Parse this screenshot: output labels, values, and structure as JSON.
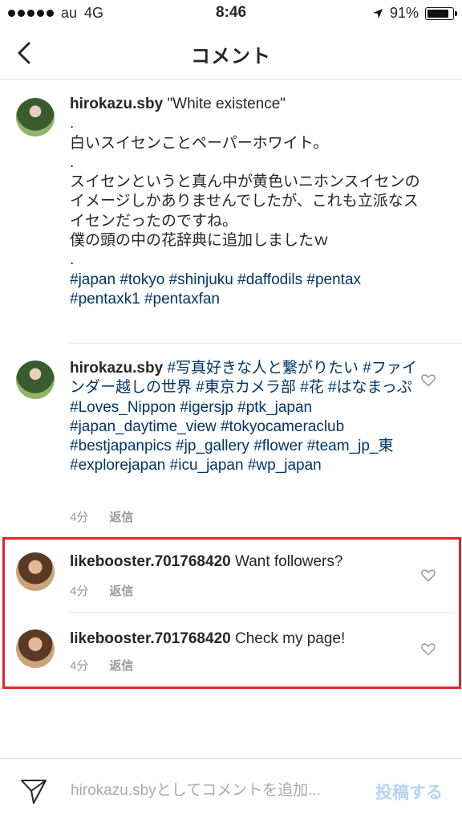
{
  "status_bar": {
    "carrier": "au",
    "network": "4G",
    "time": "8:46",
    "battery": "91%"
  },
  "nav": {
    "title": "コメント"
  },
  "caption": {
    "username": "hirokazu.sby",
    "text": "\"White existence\"\n.\n白いスイセンことペーパーホワイト。\n.\nスイセンというと真ん中が黄色いニホンスイセンのイメージしかありませんでしたが、これも立派なスイセンだったのですね。\n僕の頭の中の花辞典に追加しましたｗ\n.",
    "tags": "#japan #tokyo #shinjuku #daffodils #pentax #pentaxk1 #pentaxfan"
  },
  "comments": [
    {
      "username": "hirokazu.sby",
      "text": "#写真好きな人と繋がりたい #ファインダー越しの世界 #東京カメラ部 #花 #はなまっぷ #Loves_Nippon #igersjp #ptk_japan #japan_daytime_view #tokyocameraclub #bestjapanpics #jp_gallery #flower #team_jp_東 #explorejapan #icu_japan #wp_japan",
      "time": "4分",
      "reply": "返信"
    },
    {
      "username": "likebooster.701768420",
      "text": "Want followers?",
      "time": "4分",
      "reply": "返信"
    },
    {
      "username": "likebooster.701768420",
      "text": "Check my page!",
      "time": "4分",
      "reply": "返信"
    }
  ],
  "input": {
    "placeholder": "hirokazu.sbyとしてコメントを追加...",
    "post_label": "投稿する"
  },
  "colors": {
    "hashtag": "#003569",
    "highlight_border": "#e0262d",
    "post_disabled": "#b3d4f5"
  },
  "icons": [
    "back-chevron-icon",
    "location-arrow-icon",
    "battery-icon",
    "heart-icon",
    "send-icon"
  ]
}
